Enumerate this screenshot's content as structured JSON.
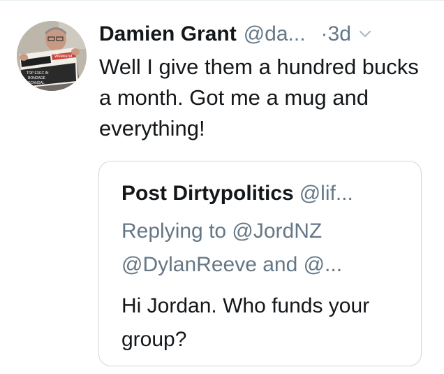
{
  "tweet": {
    "author_name": "Damien Grant",
    "author_handle": "@da...",
    "time": "·3d",
    "text": "Well I give them a hundred bucks a month. Got me a mug and everything!",
    "avatar_newspaper_text": "Weekend",
    "avatar_headline_text": "TOP EXEC IN BONDAGE SCANDAL"
  },
  "quoted_tweet": {
    "author_name": "Post Dirtypolitics",
    "author_handle": "@lif...",
    "replying_line1": "Replying to @JordNZ",
    "replying_line2": "@DylanReeve and @...",
    "text": "Hi Jordan. Who funds your group?"
  },
  "colors": {
    "primary_text": "#14171a",
    "secondary_text": "#657786",
    "border": "#ccd6dd"
  },
  "icons": {
    "caret": "chevron-down-icon"
  }
}
